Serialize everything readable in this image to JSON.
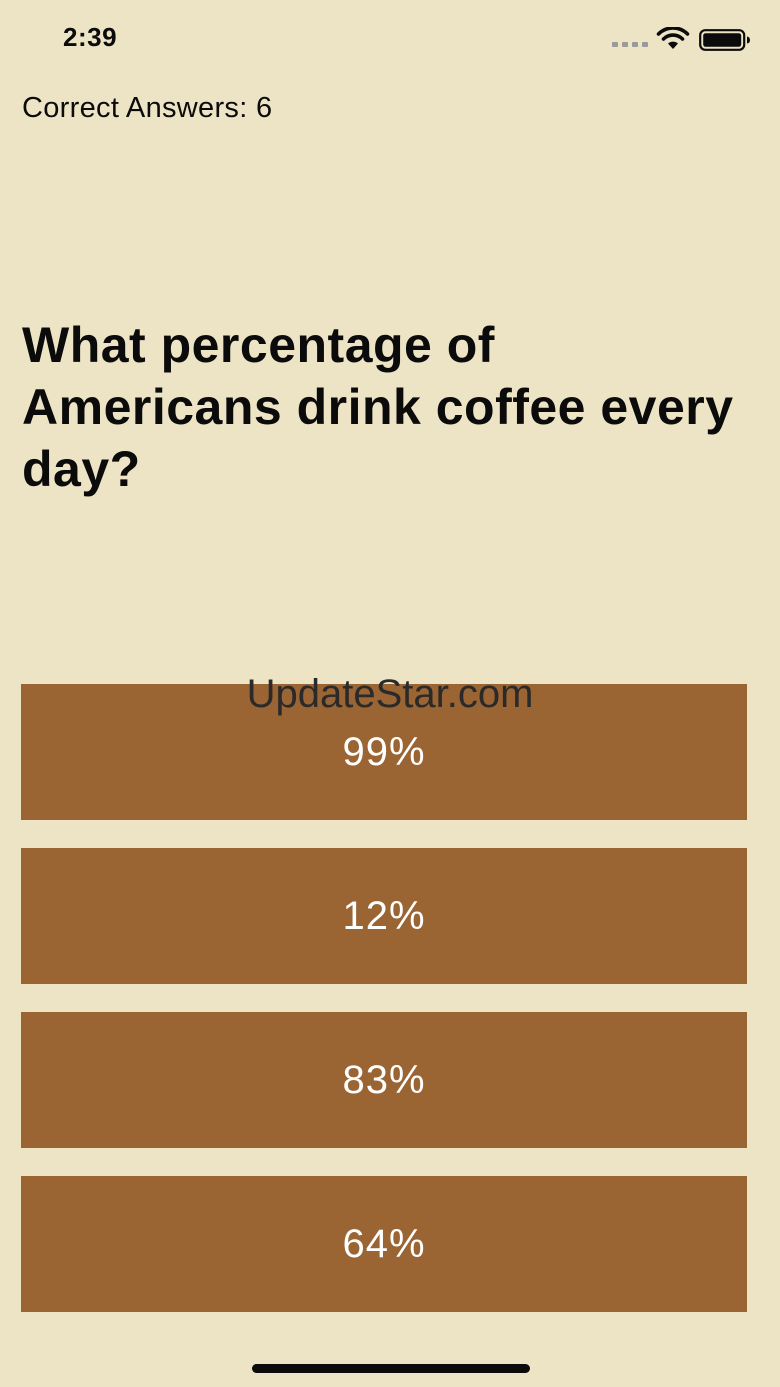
{
  "status_bar": {
    "time": "2:39"
  },
  "score": {
    "label": "Correct Answers: 6"
  },
  "question": {
    "text": "What percentage of Americans drink coffee every day?"
  },
  "watermark": {
    "text": "UpdateStar.com"
  },
  "answers": [
    {
      "label": "99%"
    },
    {
      "label": "12%"
    },
    {
      "label": "83%"
    },
    {
      "label": "64%"
    }
  ],
  "colors": {
    "background": "#EDE3C5",
    "answer_button": "#9A6433",
    "answer_text": "#FFFFFF",
    "text": "#0B0B0B"
  },
  "icons": [
    "signal-icon",
    "wifi-icon",
    "battery-icon"
  ]
}
